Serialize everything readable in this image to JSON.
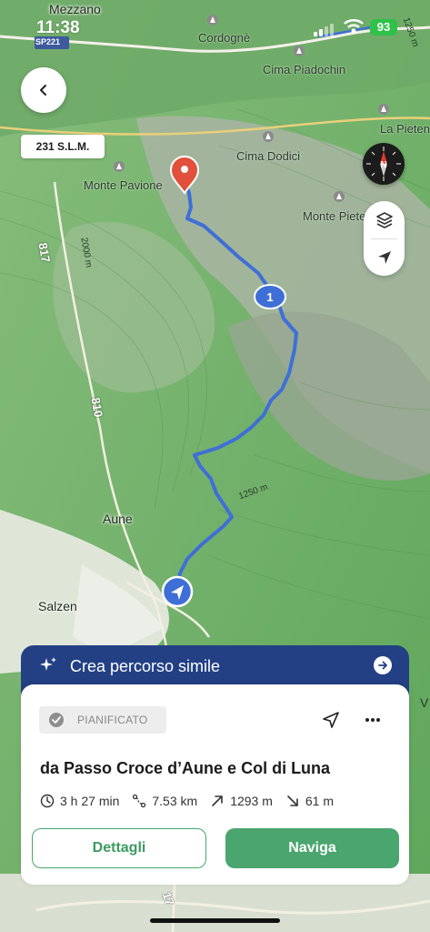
{
  "status_bar": {
    "time": "11:38",
    "battery": "93"
  },
  "map": {
    "altitude_chip": "231 S.L.M.",
    "road_sign": "SP221",
    "labels": {
      "mezzano": "Mezzano",
      "cordogne": "Cordognè",
      "cima_piadochin": "Cima Piadochin",
      "la_pietena": "La Pietena",
      "cima_dodici": "Cima Dodici",
      "monte_pavione": "Monte Pavione",
      "monte_pietena": "Monte Pietena",
      "contour_2000": "2000 m",
      "contour_1250_top": "1250 m",
      "contour_1250": "1250 m",
      "aune": "Aune",
      "salzen": "Salzen",
      "road_817": "817",
      "road_810": "810",
      "road_17": "17",
      "edge_v": "V"
    },
    "waypoint_number": "1"
  },
  "icons": {
    "back": "chevron-left-icon",
    "compass": "compass-icon",
    "layers": "layers-icon",
    "locate": "location-arrow-icon",
    "sparkle": "sparkle-icon",
    "arrow": "arrow-right-icon",
    "check": "check-circle-icon",
    "share": "share-icon",
    "more": "more-icon"
  },
  "ai_banner": {
    "label": "Crea percorso simile"
  },
  "route_card": {
    "status": "PIANIFICATO",
    "title": "da Passo Croce d’Aune e Col di Luna",
    "duration": "3 h 27 min",
    "distance": "7.53 km",
    "ascent": "1293 m",
    "descent": "61 m",
    "details_label": "Dettagli",
    "navigate_label": "Naviga"
  },
  "colors": {
    "route": "#3f6fd6",
    "banner": "#234085",
    "primary": "#4aa56f",
    "pin": "#e0503a"
  }
}
